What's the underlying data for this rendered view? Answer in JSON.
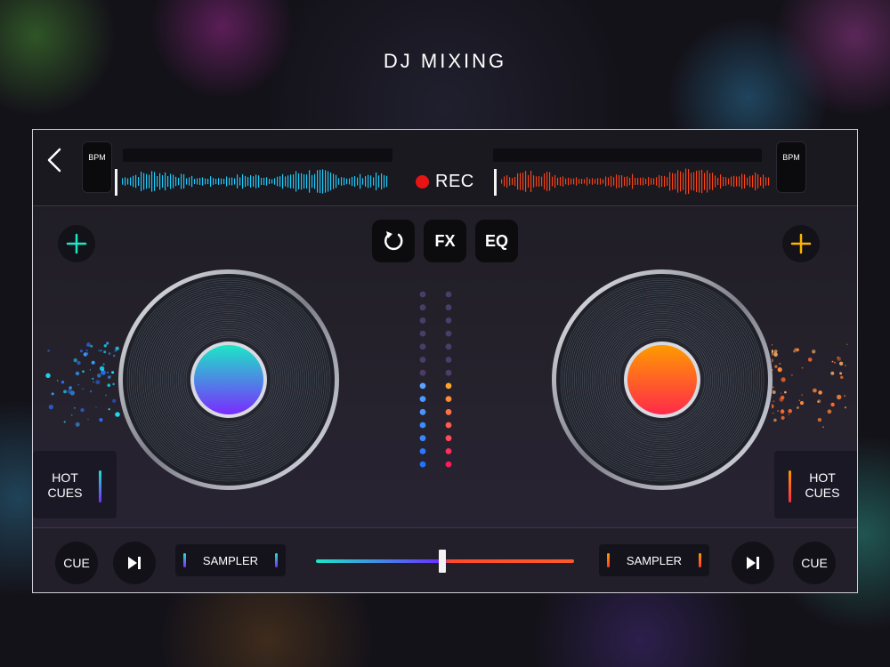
{
  "header": {
    "title": "DJ MIXING"
  },
  "topbar": {
    "bpm_left": "BPM",
    "bpm_right": "BPM",
    "rec_label": "REC"
  },
  "controls": {
    "fx_label": "FX",
    "eq_label": "EQ"
  },
  "deck_left": {
    "hot_cues_label": "HOT CUES",
    "cue_label": "CUE",
    "sampler_label": "SAMPLER"
  },
  "deck_right": {
    "hot_cues_label": "HOT CUES",
    "cue_label": "CUE",
    "sampler_label": "SAMPLER"
  },
  "crossfader": {
    "position": 0.49
  },
  "colors": {
    "left_accent": "#1de6c6",
    "left_accent_2": "#7a2bff",
    "right_accent": "#ff9a00",
    "right_accent_2": "#ff2a4a",
    "rec": "#e81414"
  }
}
